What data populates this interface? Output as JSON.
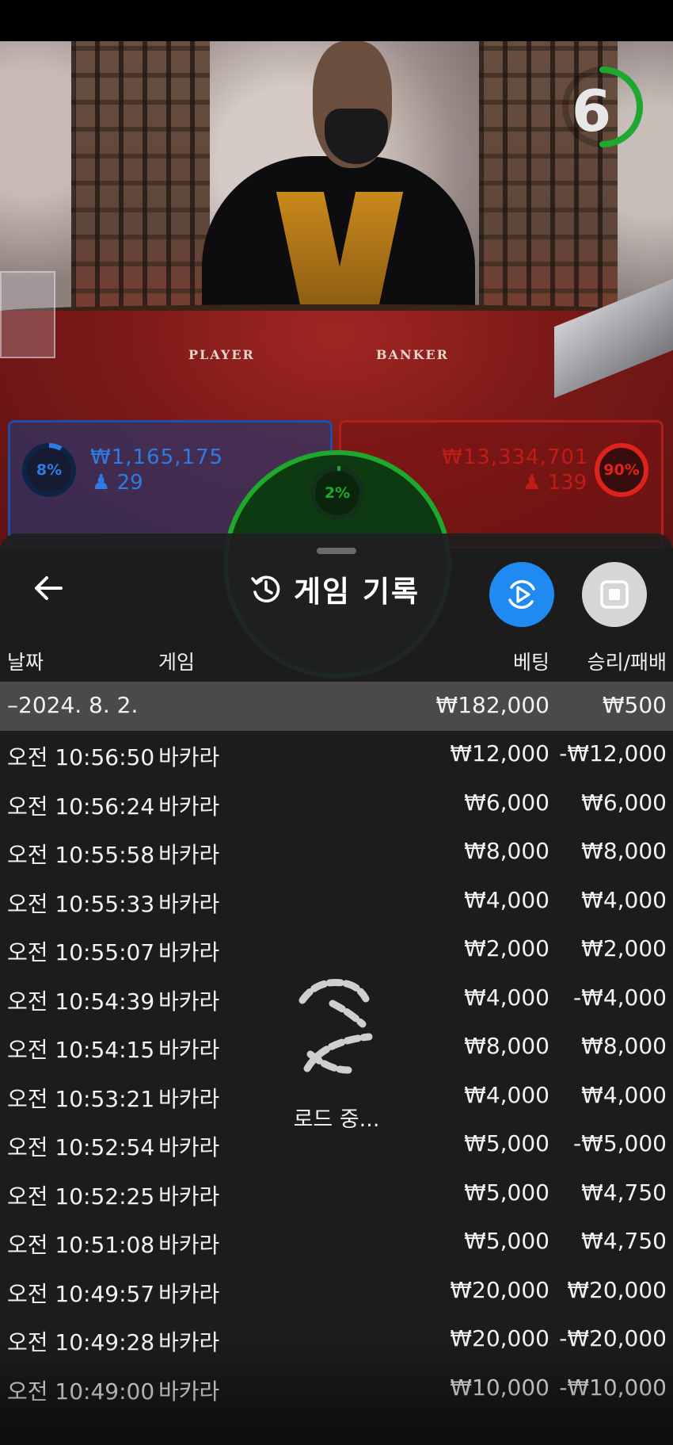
{
  "video": {
    "timer_value": "6",
    "table_labels": {
      "player": "PLAYER",
      "banker": "BANKER"
    },
    "player_bet": {
      "percent": "8%",
      "amount": "₩1,165,175",
      "bettors": "29",
      "color": "#2f7be6"
    },
    "banker_bet": {
      "percent": "90%",
      "amount": "₩13,334,701",
      "bettors": "139",
      "color": "#e0221c"
    },
    "tie_bet": {
      "percent": "2%",
      "color": "#1fa82e"
    }
  },
  "sheet": {
    "title": "게임 기록",
    "icons": {
      "back": "arrow-left-icon",
      "history": "history-icon",
      "play": "play-rotate-icon",
      "stop": "stop-icon"
    },
    "columns": {
      "date": "날짜",
      "game": "게임",
      "bet": "베팅",
      "result": "승리/패배"
    },
    "summary": {
      "date": "–2024. 8. 2.",
      "bet": "₩182,000",
      "result": "₩500"
    },
    "rows": [
      {
        "time": "오전 10:56:50",
        "game": "바카라",
        "bet": "₩12,000",
        "result": "-₩12,000"
      },
      {
        "time": "오전 10:56:24",
        "game": "바카라",
        "bet": "₩6,000",
        "result": "₩6,000"
      },
      {
        "time": "오전 10:55:58",
        "game": "바카라",
        "bet": "₩8,000",
        "result": "₩8,000"
      },
      {
        "time": "오전 10:55:33",
        "game": "바카라",
        "bet": "₩4,000",
        "result": "₩4,000"
      },
      {
        "time": "오전 10:55:07",
        "game": "바카라",
        "bet": "₩2,000",
        "result": "₩2,000"
      },
      {
        "time": "오전 10:54:39",
        "game": "바카라",
        "bet": "₩4,000",
        "result": "-₩4,000"
      },
      {
        "time": "오전 10:54:15",
        "game": "바카라",
        "bet": "₩8,000",
        "result": "₩8,000"
      },
      {
        "time": "오전 10:53:21",
        "game": "바카라",
        "bet": "₩4,000",
        "result": "₩4,000"
      },
      {
        "time": "오전 10:52:54",
        "game": "바카라",
        "bet": "₩5,000",
        "result": "-₩5,000"
      },
      {
        "time": "오전 10:52:25",
        "game": "바카라",
        "bet": "₩5,000",
        "result": "₩4,750"
      },
      {
        "time": "오전 10:51:08",
        "game": "바카라",
        "bet": "₩5,000",
        "result": "₩4,750"
      },
      {
        "time": "오전 10:49:57",
        "game": "바카라",
        "bet": "₩20,000",
        "result": "₩20,000"
      },
      {
        "time": "오전 10:49:28",
        "game": "바카라",
        "bet": "₩20,000",
        "result": "-₩20,000"
      },
      {
        "time": "오전 10:49:00",
        "game": "바카라",
        "bet": "₩10,000",
        "result": "-₩10,000"
      }
    ],
    "loading_text": "로드 중..."
  }
}
